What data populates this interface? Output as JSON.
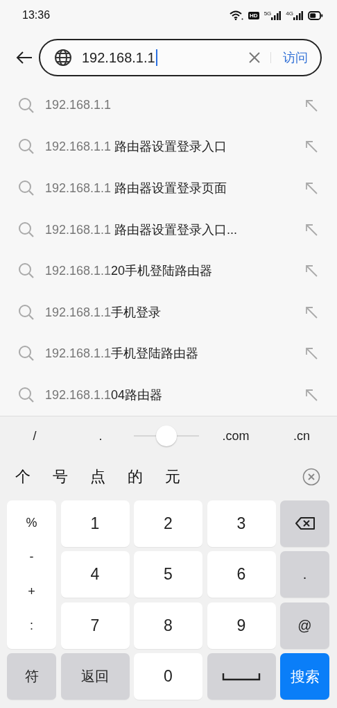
{
  "status_bar": {
    "time": "13:36",
    "hd_label": "HD",
    "network_labels": [
      "5G",
      "4G"
    ]
  },
  "address_bar": {
    "value": "192.168.1.1",
    "visit_label": "访问"
  },
  "suggestions": [
    {
      "match": "192.168.1.1"
    },
    {
      "match": "192.168.1.1",
      "rest": " 路由器设置登录入口"
    },
    {
      "match": "192.168.1.1",
      "rest": " 路由器设置登录页面"
    },
    {
      "match": "192.168.1.1",
      "rest": " 路由器设置登录入口..."
    },
    {
      "match": "192.168.1.1",
      "rest": "20手机登陆路由器"
    },
    {
      "match": "192.168.1.1",
      "rest": "手机登录"
    },
    {
      "match": "192.168.1.1",
      "rest": "手机登陆路由器"
    },
    {
      "match": "192.168.1.1",
      "rest": "04路由器"
    }
  ],
  "shortcut_bar": {
    "left": [
      "/",
      "."
    ],
    "cursor_slider": {
      "level": 0.5
    },
    "right": [
      ".com",
      ".cn"
    ]
  },
  "candidates": [
    "个",
    "号",
    "点",
    "的",
    "元"
  ],
  "keyboard": {
    "symbols": [
      "%",
      "-",
      "+",
      ":"
    ],
    "keys": [
      {
        "kind": "digit",
        "label": "1"
      },
      {
        "kind": "digit",
        "label": "2"
      },
      {
        "kind": "digit",
        "label": "3"
      },
      {
        "kind": "backspace"
      },
      {
        "kind": "digit",
        "label": "4"
      },
      {
        "kind": "digit",
        "label": "5"
      },
      {
        "kind": "digit",
        "label": "6"
      },
      {
        "kind": "function",
        "label": "."
      },
      {
        "kind": "digit",
        "label": "7"
      },
      {
        "kind": "digit",
        "label": "8"
      },
      {
        "kind": "digit",
        "label": "9"
      },
      {
        "kind": "function",
        "label": "@"
      },
      {
        "kind": "function",
        "label": "符"
      },
      {
        "kind": "function",
        "label": "返回"
      },
      {
        "kind": "digit",
        "label": "0"
      },
      {
        "kind": "space"
      },
      {
        "kind": "action",
        "label": "搜索"
      }
    ]
  }
}
